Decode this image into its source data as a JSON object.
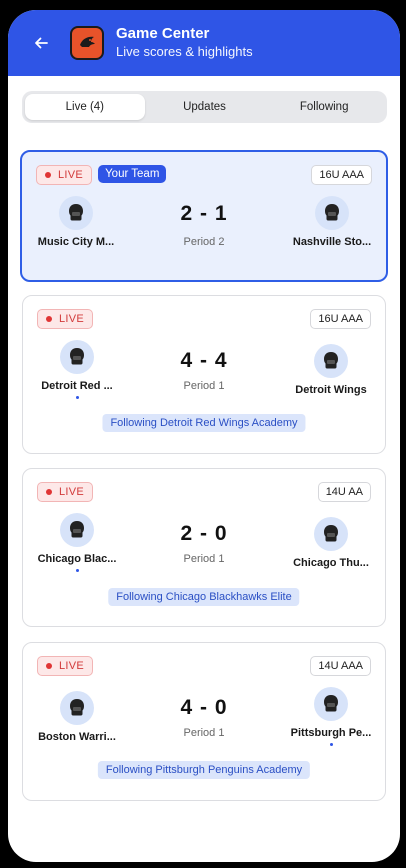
{
  "header": {
    "title": "Game Center",
    "subtitle": "Live scores & highlights",
    "back_icon": "arrow-left-icon",
    "logo_icon": "app-logo-icon",
    "brand_color": "#2f55e6"
  },
  "tabs": [
    {
      "label": "Live (4)",
      "active": true
    },
    {
      "label": "Updates",
      "active": false
    },
    {
      "label": "Following",
      "active": false
    }
  ],
  "games": [
    {
      "live_label": "LIVE",
      "your_team_label": "Your Team",
      "age_group": "16U AAA",
      "home": {
        "name": "Music City M..."
      },
      "away": {
        "name": "Nashville Sto..."
      },
      "score": "2  - 1",
      "period": "Period 2"
    },
    {
      "live_label": "LIVE",
      "age_group": "16U AAA",
      "home": {
        "name": "Detroit Red ..."
      },
      "away": {
        "name": "Detroit Wings"
      },
      "score": "4 - 4",
      "period": "Period 1",
      "following": "Following Detroit Red Wings Academy"
    },
    {
      "live_label": "LIVE",
      "age_group": "14U AA",
      "home": {
        "name": "Chicago Blac..."
      },
      "away": {
        "name": "Chicago Thu..."
      },
      "score": "2 - 0",
      "period": "Period 1",
      "following": "Following Chicago Blackhawks Elite"
    },
    {
      "live_label": "LIVE",
      "age_group": "14U AAA",
      "home": {
        "name": "Boston Warri..."
      },
      "away": {
        "name": "Pittsburgh Pe..."
      },
      "score": "4 - 0",
      "period": "Period 1",
      "following": "Following Pittsburgh Penguins Academy"
    }
  ]
}
